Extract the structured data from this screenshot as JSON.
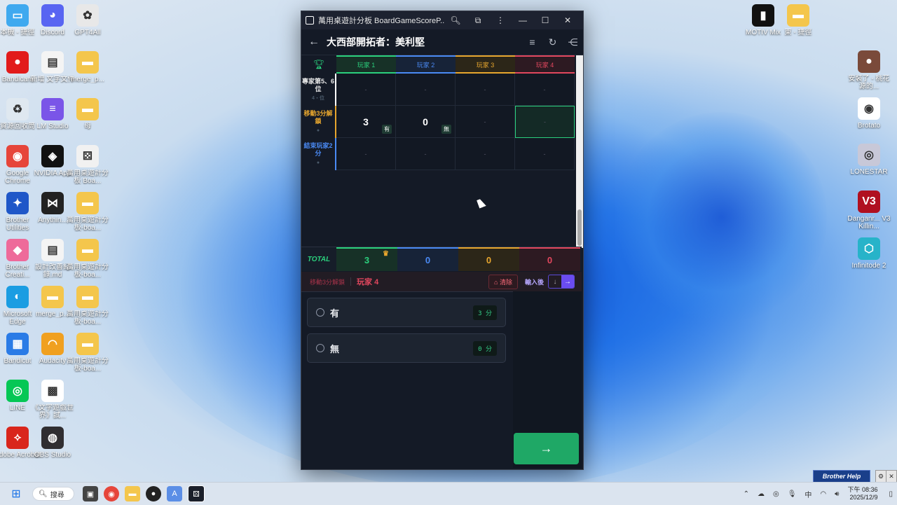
{
  "desktop_left": [
    {
      "label": "本機 - 捷徑",
      "color": "#3fa9ef",
      "glyph": "▭"
    },
    {
      "label": "Discord",
      "color": "#5865f2",
      "glyph": "◕"
    },
    {
      "label": "GPT4All",
      "color": "#e8e8e8",
      "glyph": "✿"
    },
    {
      "label": "Bandicam",
      "color": "#e21b1b",
      "glyph": "●"
    },
    {
      "label": "新增 文字文件",
      "color": "#f4f4f4",
      "glyph": "▤"
    },
    {
      "label": "merge_p...",
      "color": "#f4c64c",
      "glyph": "▬"
    },
    {
      "label": "資源回收筒",
      "color": "#dfe8f0",
      "glyph": "♻"
    },
    {
      "label": "LM Studio",
      "color": "#7a55e8",
      "glyph": "≡"
    },
    {
      "label": "母",
      "color": "#f4c64c",
      "glyph": "▬"
    },
    {
      "label": "Google Chrome",
      "color": "#e6453a",
      "glyph": "◉"
    },
    {
      "label": "NVIDIA App",
      "color": "#111",
      "glyph": "◈"
    },
    {
      "label": "萬用桌遊計分板 Boa...",
      "color": "#f1f1f1",
      "glyph": "⚄"
    },
    {
      "label": "Brother Utilities",
      "color": "#1f57c8",
      "glyph": "✦"
    },
    {
      "label": "Anythin...",
      "color": "#222",
      "glyph": "⋈"
    },
    {
      "label": "萬用桌遊計分板-boa...",
      "color": "#f4c64c",
      "glyph": "▬"
    },
    {
      "label": "Brother Creati...",
      "color": "#ee6a9a",
      "glyph": "◆"
    },
    {
      "label": "設計改善紀錄.md",
      "color": "#f4f4f4",
      "glyph": "▤"
    },
    {
      "label": "萬用桌遊計分板-boa...",
      "color": "#f4c64c",
      "glyph": "▬"
    },
    {
      "label": "Microsoft Edge",
      "color": "#1b9de2",
      "glyph": "◐"
    },
    {
      "label": "merge_p...",
      "color": "#f4c64c",
      "glyph": "▬"
    },
    {
      "label": "萬用桌遊計分板-boa...",
      "color": "#f4c64c",
      "glyph": "▬"
    },
    {
      "label": "Bandicut",
      "color": "#2a7be6",
      "glyph": "▦"
    },
    {
      "label": "Audacity",
      "color": "#f0a020",
      "glyph": "◠"
    },
    {
      "label": "萬用桌遊計分板-boa...",
      "color": "#f4c64c",
      "glyph": "▬"
    },
    {
      "label": "LINE",
      "color": "#06c755",
      "glyph": "◎"
    },
    {
      "label": "《文字遊戲世界》試...",
      "color": "#fff",
      "glyph": "▩"
    },
    {
      "label": "",
      "color": "rgba(0,0,0,0)",
      "glyph": ""
    },
    {
      "label": "Adobe Acrobat",
      "color": "#d9261c",
      "glyph": "⟡"
    },
    {
      "label": "OBS Studio",
      "color": "#302e31",
      "glyph": "◍"
    }
  ],
  "desktop_right": [
    {
      "label": "MOTIV Mix",
      "color": "#111",
      "glyph": "▮"
    },
    {
      "label": "東 - 捷徑",
      "color": "#f4c64c",
      "glyph": "▬"
    },
    {
      "label": "安裝了 - 桃花源的...",
      "color": "#7a4a3a",
      "glyph": "●"
    },
    {
      "label": "Brotato",
      "color": "#fff",
      "glyph": "◉"
    },
    {
      "label": "LONESTAR",
      "color": "#c8c8d8",
      "glyph": "◎"
    },
    {
      "label": "Danganr... V3 Killin...",
      "color": "#b01020",
      "glyph": "V3"
    },
    {
      "label": "Infinitode 2",
      "color": "#27b3c9",
      "glyph": "⬡"
    }
  ],
  "window": {
    "title": "萬用桌遊計分板 BoardGameScoreP...",
    "app_title": "大西部開拓者：美利堅"
  },
  "grid": {
    "players": [
      {
        "label": "玩家 1",
        "color": "#2bd07d",
        "bg": "#173127"
      },
      {
        "label": "玩家 2",
        "color": "#4a8af4",
        "bg": "#172338"
      },
      {
        "label": "玩家 3",
        "color": "#e7a62e",
        "bg": "#2c2618"
      },
      {
        "label": "玩家 4",
        "color": "#e2475e",
        "bg": "#2d1a22"
      }
    ],
    "rows": [
      {
        "label": "專家第5、6位",
        "sub": "4・位",
        "color": "#e8e8e8",
        "border": "#ffffff",
        "cells": [
          "-",
          "-",
          "-",
          "-"
        ],
        "tags": [
          "",
          "",
          "",
          ""
        ]
      },
      {
        "label": "移動3分解鎖",
        "sub": "●",
        "color": "#e7a62e",
        "border": "#e7a62e",
        "cells": [
          "3",
          "0",
          "-",
          "-"
        ],
        "tags": [
          "有",
          "無",
          "",
          ""
        ]
      },
      {
        "label": "結束玩家2分",
        "sub": "●",
        "color": "#4a8af4",
        "border": "#4a8af4",
        "cells": [
          "-",
          "-",
          "-",
          "-"
        ],
        "tags": [
          "",
          "",
          "",
          ""
        ]
      }
    ]
  },
  "total": {
    "label": "TOTAL",
    "values": [
      "3",
      "0",
      "0",
      "0"
    ],
    "crown": "♛"
  },
  "input_bar": {
    "category": "移動3分解鎖",
    "player": "玩家 4",
    "clear_label": "清除",
    "after_label": "輸入後",
    "down_arrow": "↓",
    "right_arrow": "→"
  },
  "options": [
    {
      "label": "有",
      "points": "3 分"
    },
    {
      "label": "無",
      "points": "0 分"
    }
  ],
  "next_button": "→",
  "taskbar": {
    "search": "搜尋",
    "time": "下午 08:36",
    "date": "2025/12/9",
    "ime": "中"
  },
  "brother_help": "Brother Help"
}
